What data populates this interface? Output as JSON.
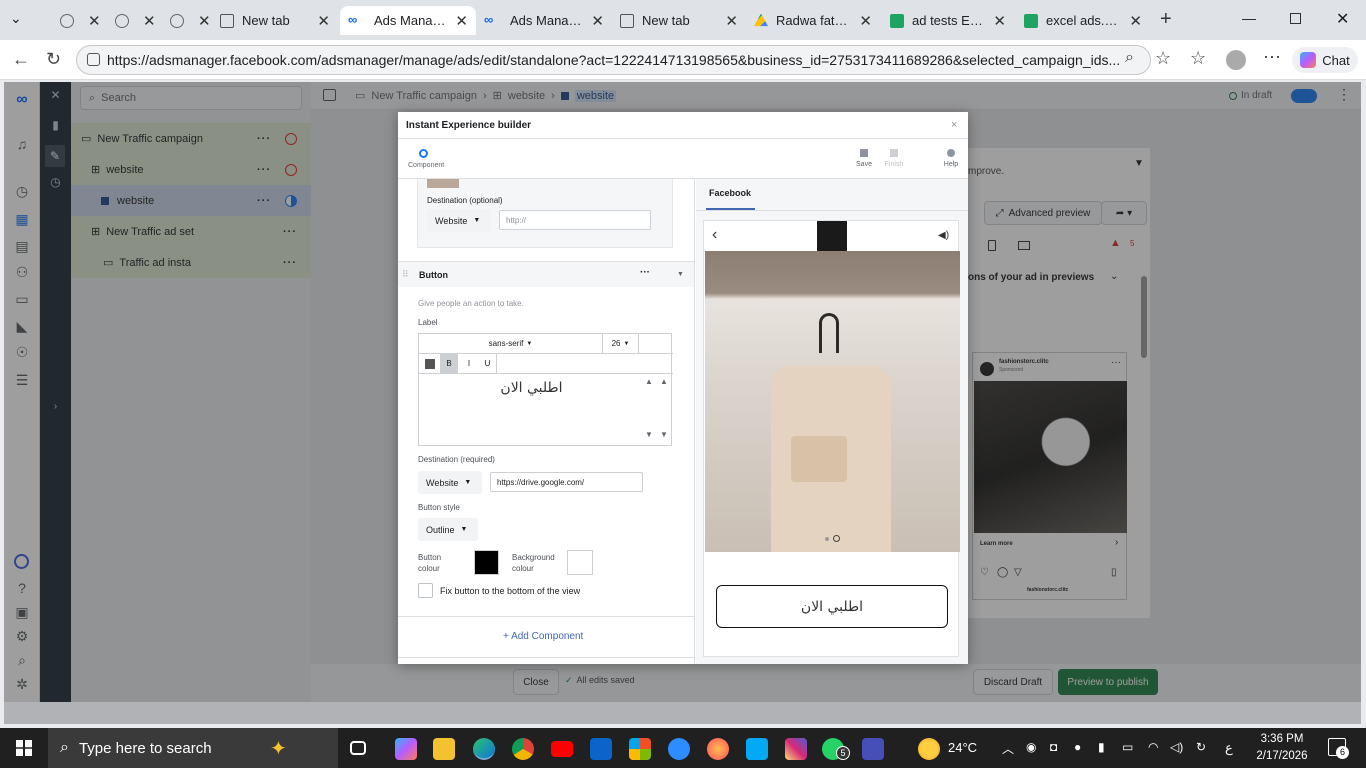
{
  "browser": {
    "tabs": [
      {
        "label": "",
        "favicon": "globe-icon"
      },
      {
        "label": "",
        "favicon": "globe-icon"
      },
      {
        "label": "",
        "favicon": "globe-icon"
      },
      {
        "label": "New tab",
        "favicon": "newtab-icon"
      },
      {
        "label": "Ads Manager -",
        "favicon": "meta-icon",
        "active": true
      },
      {
        "label": "Ads Manager -",
        "favicon": "meta-icon"
      },
      {
        "label": "New tab",
        "favicon": "newtab-icon"
      },
      {
        "label": "Radwa fathi - G",
        "favicon": "drive-icon"
      },
      {
        "label": "ad tests Excel s",
        "favicon": "sheets-icon"
      },
      {
        "label": "excel ads.xlsx",
        "favicon": "sheets-icon"
      }
    ],
    "url": "https://adsmanager.facebook.com/adsmanager/manage/ads/edit/standalone?act=1222414713198565&business_id=2753173411689286&selected_campaign_ids...",
    "chat_label": "Chat"
  },
  "sidebar_search": {
    "placeholder": "Search"
  },
  "tree": [
    {
      "label": "New Traffic campaign",
      "icon": "folder-icon",
      "status": "error"
    },
    {
      "label": "website",
      "icon": "adset-icon",
      "status": "error"
    },
    {
      "label": "website",
      "icon": "ad-icon",
      "status": "partial"
    },
    {
      "label": "New Traffic ad set",
      "icon": "adset-icon",
      "status": ""
    },
    {
      "label": "Traffic ad insta",
      "icon": "ad-icon",
      "status": ""
    }
  ],
  "topbar": {
    "crumbs": [
      "New Traffic campaign",
      "website",
      "website"
    ],
    "draft_status": "In draft"
  },
  "background_panel": {
    "hint": "mprove.",
    "advanced_preview": "Advanced preview",
    "issues_count": "5",
    "previews_text": "ons of your ad in previews",
    "card_page": "fashionstorc.clitc",
    "card_sponsored": "Sponsored",
    "card_cta": "Learn more",
    "card_footer": "fashionstorc.clitc"
  },
  "modal": {
    "title": "Instant Experience builder",
    "tool_component": "Component",
    "tool_save": "Save",
    "tool_finish": "Finish",
    "tool_help": "Help",
    "dest_optional_label": "Destination (optional)",
    "dest_optional_type": "Website",
    "dest_optional_placeholder": "http://",
    "button_section_title": "Button",
    "button_desc": "Give people an action to take.",
    "label_title": "Label",
    "font_family": "sans-serif",
    "font_size": "26",
    "fmt_bold": "B",
    "fmt_italic": "I",
    "fmt_underline": "U",
    "label_text": "اطلبي الان",
    "dest_required_label": "Destination (required)",
    "dest_required_type": "Website",
    "dest_required_url": "https://drive.google.com/",
    "button_style_label": "Button style",
    "button_style_value": "Outline",
    "button_colour_label": "Button colour",
    "background_colour_label": "Background colour",
    "button_colour": "#000000",
    "background_colour": "#ffffff",
    "fix_button_label": "Fix button to the bottom of the view",
    "add_component": "+ Add Component",
    "preview_tab": "Facebook",
    "preview_cta": "اطلبي الان"
  },
  "bottombar": {
    "close": "Close",
    "saved": "All edits saved",
    "discard": "Discard Draft",
    "publish": "Preview to publish"
  },
  "taskbar": {
    "search_placeholder": "Type here to search",
    "weather": "24°C",
    "time": "3:36 PM",
    "date": "2/17/2026",
    "lang": "ع",
    "notif_count": "6",
    "whatsapp_badge": "5"
  }
}
